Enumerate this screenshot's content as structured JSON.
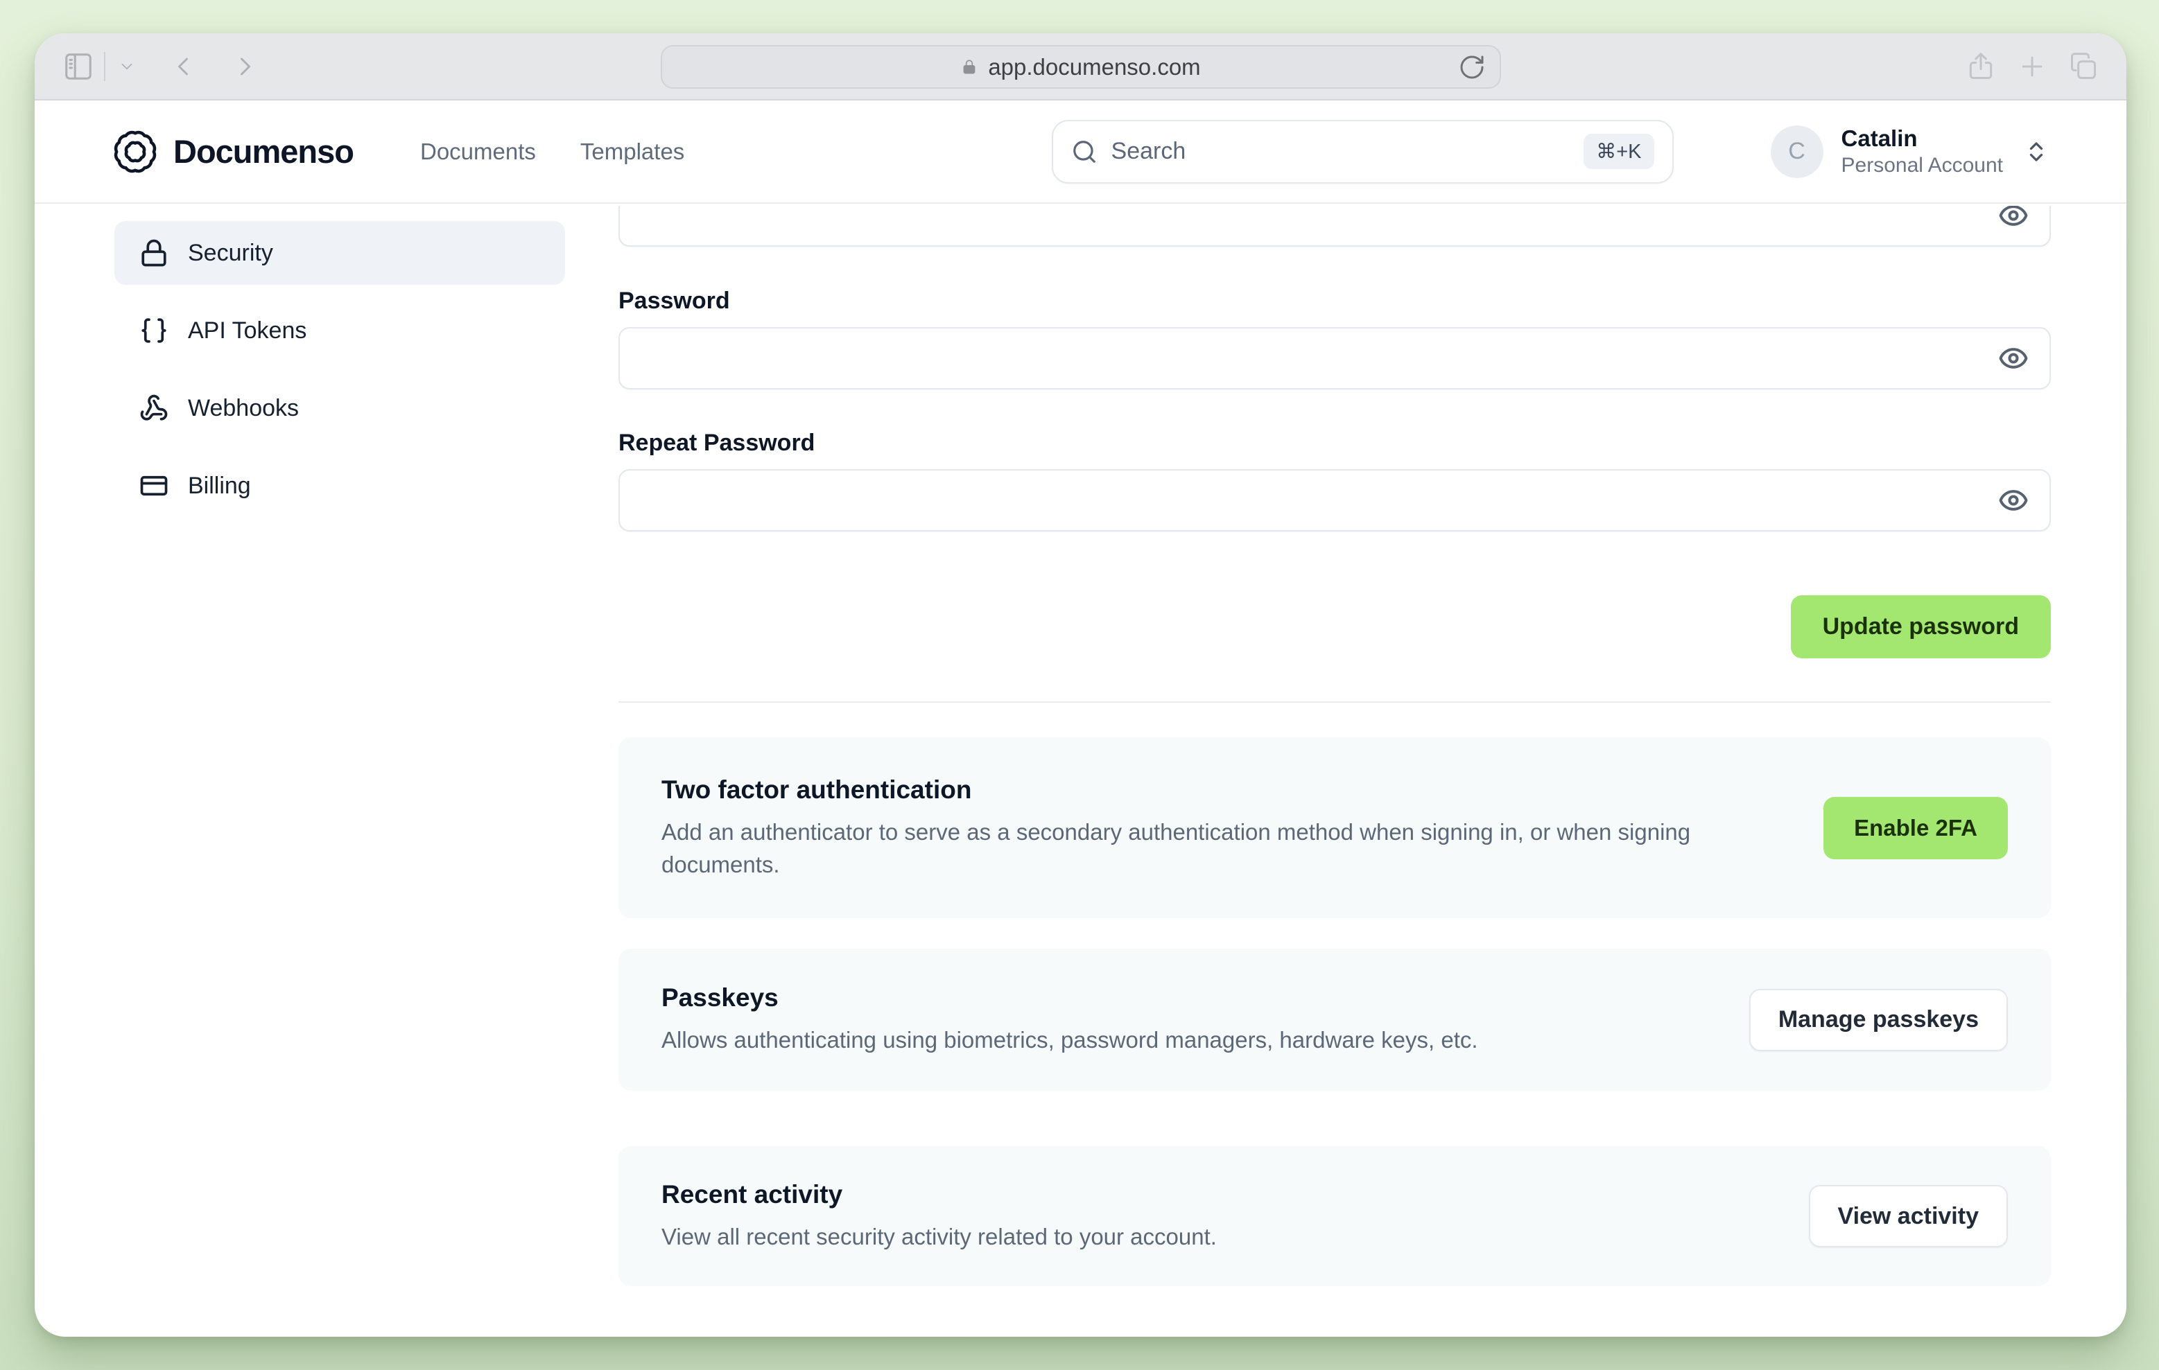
{
  "browser": {
    "url": "app.documenso.com"
  },
  "header": {
    "brand": "Documenso",
    "nav": [
      {
        "label": "Documents"
      },
      {
        "label": "Templates"
      }
    ],
    "search": {
      "placeholder": "Search",
      "shortcut": "⌘+K"
    },
    "account": {
      "initial": "C",
      "name": "Catalin",
      "type": "Personal Account"
    }
  },
  "sidebar": {
    "items": [
      {
        "label": "Security",
        "icon": "lock-icon",
        "active": true
      },
      {
        "label": "API Tokens",
        "icon": "braces-icon",
        "active": false
      },
      {
        "label": "Webhooks",
        "icon": "webhook-icon",
        "active": false
      },
      {
        "label": "Billing",
        "icon": "credit-card-icon",
        "active": false
      }
    ]
  },
  "password_form": {
    "current_password_value": "",
    "password_label": "Password",
    "password_value": "",
    "repeat_label": "Repeat Password",
    "repeat_value": "",
    "submit_label": "Update password"
  },
  "sections": [
    {
      "title": "Two factor authentication",
      "description": "Add an authenticator to serve as a secondary authentication method when signing in, or when signing documents.",
      "button": "Enable 2FA",
      "button_style": "primary"
    },
    {
      "title": "Passkeys",
      "description": "Allows authenticating using biometrics, password managers, hardware keys, etc.",
      "button": "Manage passkeys",
      "button_style": "outline"
    },
    {
      "title": "Recent activity",
      "description": "View all recent security activity related to your account.",
      "button": "View activity",
      "button_style": "outline"
    }
  ],
  "colors": {
    "accent_green": "#a3e771",
    "accent_green_text": "#1b3109",
    "desktop_background": "#dcebd0",
    "card_background": "#f6fafa",
    "active_sidebar_item": "#eff2f6"
  }
}
